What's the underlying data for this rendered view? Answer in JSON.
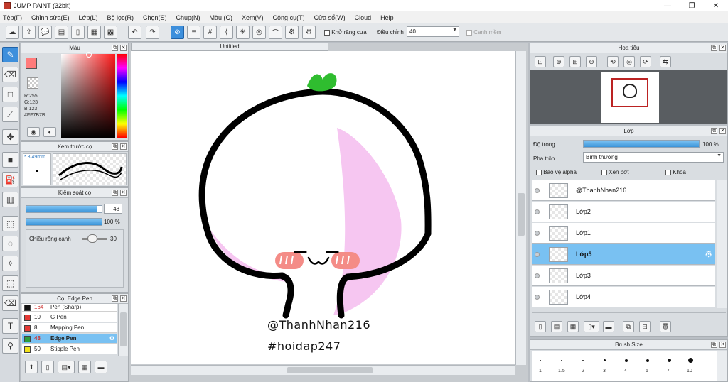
{
  "window": {
    "title": "JUMP PAINT (32bit)",
    "minimize": "—",
    "maximize": "❐",
    "close": "✕"
  },
  "menu": [
    "Tệp(F)",
    "Chỉnh sửa(E)",
    "Lớp(L)",
    "Bộ lọc(R)",
    "Chọn(S)",
    "Chụp(N)",
    "Màu (C)",
    "Xem(V)",
    "Công cụ(T)",
    "Cửa sổ(W)",
    "Cloud",
    "Help"
  ],
  "toolbar": {
    "antialias_label": "Khử răng cưa",
    "correction_label": "Điều chỉnh",
    "correction_value": "40",
    "smooth_label": "Canh mềm"
  },
  "color_panel": {
    "title": "Màu",
    "r": "R:255",
    "g": "G:123",
    "b": "B:123",
    "hex": "#FF7B7B",
    "primary": "#ff7b7b"
  },
  "brush_preview": {
    "title": "Xem trước cọ",
    "size": "* 3.49mm"
  },
  "brush_control": {
    "title": "Kiểm soát cọ",
    "size_value": "48",
    "size_fraction": 0.93,
    "opacity_value": "100 %",
    "opacity_fraction": 1.0,
    "edge_label": "Chiều rộng cạnh",
    "edge_value": "30"
  },
  "brush_list": {
    "title": "Cọ: Edge Pen",
    "items": [
      {
        "size": "164",
        "name": "Pen (Sharp)",
        "color": "#111111"
      },
      {
        "size": "10",
        "name": "G Pen",
        "color": "#e53935"
      },
      {
        "size": "8",
        "name": "Mapping Pen",
        "color": "#e53935"
      },
      {
        "size": "48",
        "name": "Edge Pen",
        "color": "#2e9e3b"
      },
      {
        "size": "50",
        "name": "Stipple Pen",
        "color": "#f2e21b"
      }
    ]
  },
  "canvas": {
    "tab": "Untitled",
    "signature_line1": "@ThanhNhan216",
    "signature_line2": "#hoidap247"
  },
  "navigator": {
    "title": "Hoa tiêu"
  },
  "layer_panel": {
    "title": "Lớp",
    "opacity_label": "Độ trong",
    "opacity_value": "100 %",
    "opacity_fraction": 1.0,
    "blend_label": "Pha trộn",
    "blend_value": "Bình thường",
    "protect_alpha": "Bảo vệ alpha",
    "clipping": "Xén bớt",
    "lock": "Khóa",
    "layers": [
      {
        "name": "@ThanhNhan216"
      },
      {
        "name": "Lớp2"
      },
      {
        "name": "Lớp1"
      },
      {
        "name": "Lớp5",
        "selected": true
      },
      {
        "name": "Lớp3"
      },
      {
        "name": "Lớp4"
      }
    ]
  },
  "brush_size_panel": {
    "title": "Brush Size",
    "sizes": [
      "1",
      "1.5",
      "2",
      "3",
      "4",
      "5",
      "7",
      "10"
    ]
  }
}
